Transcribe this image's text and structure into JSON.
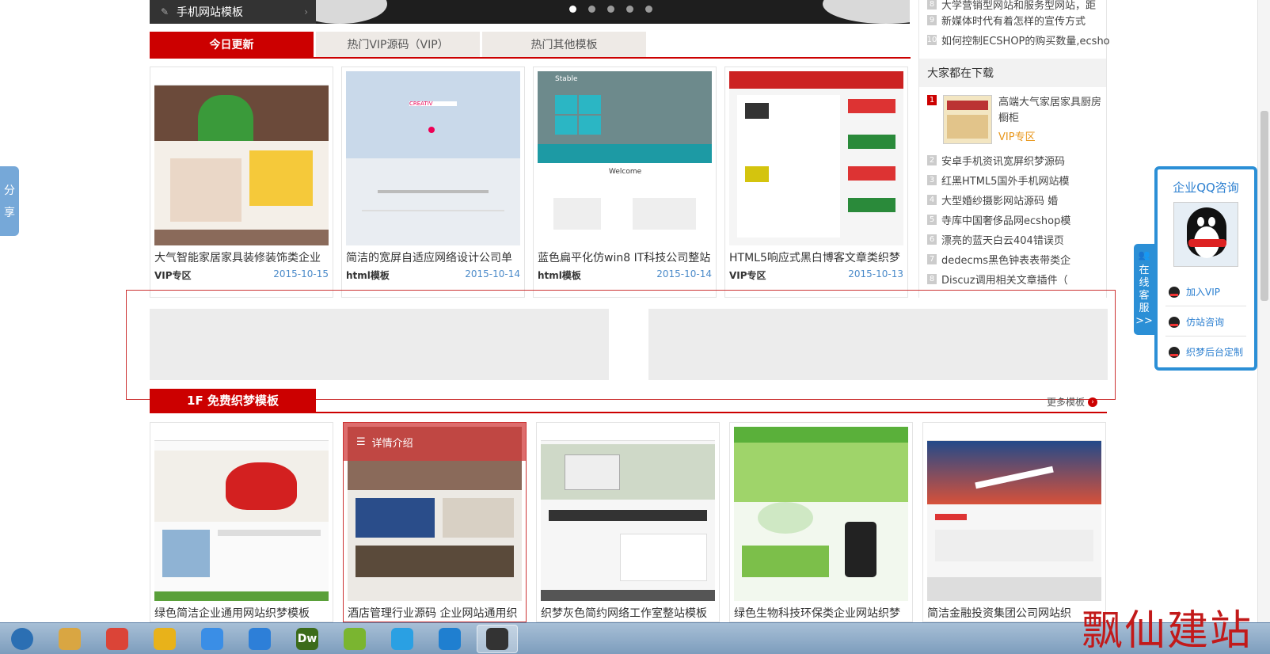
{
  "category_bar": {
    "label": "手机网站模板"
  },
  "tabs": [
    {
      "label": "今日更新"
    },
    {
      "label": "热门VIP源码（VIP）"
    },
    {
      "label": "热门其他模板"
    }
  ],
  "today_cards": [
    {
      "title": "大气智能家居家具装修装饰类企业",
      "category": "VIP专区",
      "date": "2015-10-15"
    },
    {
      "title": "简洁的宽屏自适应网络设计公司单",
      "category": "html模板",
      "date": "2015-10-14"
    },
    {
      "title": "蓝色扁平化仿win8 IT科技公司整站",
      "category": "html模板",
      "date": "2015-10-14"
    },
    {
      "title": "HTML5响应式黑白博客文章类织梦",
      "category": "VIP专区",
      "date": "2015-10-13"
    }
  ],
  "card_overlays": {
    "stable": "Stable",
    "welcome": "Welcome",
    "creativ": "CREATIV"
  },
  "sidebar": {
    "top_news": [
      {
        "num": "8",
        "text": "大学营销型网站和服务型网站，距"
      },
      {
        "num": "9",
        "text": "新媒体时代有着怎样的宣传方式"
      },
      {
        "num": "10",
        "text": "如何控制ECSHOP的购买数量,ecsho"
      }
    ],
    "download_heading": "大家都在下载",
    "featured": {
      "num": "1",
      "title": "高端大气家居家具厨房橱柜",
      "category": "VIP专区"
    },
    "downloads": [
      {
        "num": "2",
        "text": "安卓手机资讯宽屏织梦源码"
      },
      {
        "num": "3",
        "text": "红黑HTML5国外手机网站模"
      },
      {
        "num": "4",
        "text": "大型婚纱摄影网站源码 婚"
      },
      {
        "num": "5",
        "text": "寺库中国奢侈品网ecshop模"
      },
      {
        "num": "6",
        "text": "漂亮的蓝天白云404错误页"
      },
      {
        "num": "7",
        "text": "dedecms黑色钟表表带类企"
      },
      {
        "num": "8",
        "text": "Discuz调用相关文章插件（"
      }
    ]
  },
  "floor": {
    "label": "1F 免费织梦模板",
    "more": "更多模板"
  },
  "floor_cards": [
    {
      "title": "绿色简洁企业通用网站织梦模板"
    },
    {
      "title": "酒店管理行业源码 企业网站通用织",
      "overlay": "详情介绍"
    },
    {
      "title": "织梦灰色简约网络工作室整站模板"
    },
    {
      "title": "绿色生物科技环保类企业网站织梦"
    },
    {
      "title": "简洁金融投资集团公司网站织"
    }
  ],
  "share": {
    "label_1": "分",
    "label_2": "享"
  },
  "qq_service": {
    "tab_label": [
      "在",
      "线",
      "客",
      "服",
      ">>"
    ],
    "title": "企业QQ咨询",
    "links": [
      "加入VIP",
      "仿站咨询",
      "织梦后台定制"
    ]
  },
  "taskbar": {
    "apps": [
      {
        "name": "start-orb",
        "color": "#2b6fb3",
        "glyph": ""
      },
      {
        "name": "explorer",
        "color": "#d9a642",
        "glyph": ""
      },
      {
        "name": "chrome",
        "color": "#db4437",
        "glyph": ""
      },
      {
        "name": "app-green",
        "color": "#e8b21a",
        "glyph": ""
      },
      {
        "name": "app-blue",
        "color": "#3a8ee6",
        "glyph": ""
      },
      {
        "name": "sogou",
        "color": "#2d7fd8",
        "glyph": ""
      },
      {
        "name": "dreamweaver",
        "color": "#3c6b1a",
        "glyph": "Dw"
      },
      {
        "name": "app-edit",
        "color": "#7ab530",
        "glyph": ""
      },
      {
        "name": "qq",
        "color": "#2aa0e3",
        "glyph": ""
      },
      {
        "name": "app-mail",
        "color": "#1f7fd0",
        "glyph": ""
      },
      {
        "name": "app-cup",
        "color": "#333333",
        "glyph": ""
      }
    ]
  },
  "watermark": "飘仙建站",
  "colors": {
    "accent": "#cc0000",
    "link_blue": "#4a8ac9",
    "qq_blue": "#2b8fd6",
    "vip_orange": "#e8961a"
  }
}
